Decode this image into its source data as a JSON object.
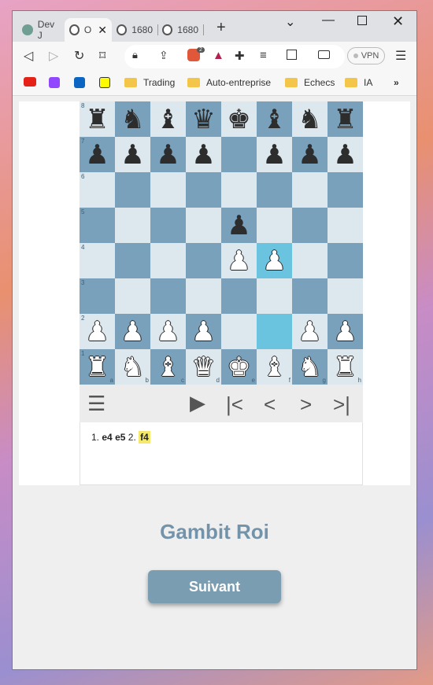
{
  "tabs": [
    {
      "label": "Dev J",
      "icon": "chatgpt-icon",
      "active": false
    },
    {
      "label": "O",
      "icon": "globe-icon",
      "active": true
    },
    {
      "label": "1680",
      "icon": "globe-icon",
      "active": false
    },
    {
      "label": "1680",
      "icon": "globe-icon",
      "active": false
    }
  ],
  "toolbar": {
    "vpn_label": "VPN",
    "brave_badge": "2"
  },
  "bookmarks": [
    {
      "label": "Trading"
    },
    {
      "label": "Auto-entreprise"
    },
    {
      "label": "Echecs"
    },
    {
      "label": "IA"
    }
  ],
  "board": {
    "ranks": [
      "8",
      "7",
      "6",
      "5",
      "4",
      "3",
      "2",
      "1"
    ],
    "files": [
      "a",
      "b",
      "c",
      "d",
      "e",
      "f",
      "g",
      "h"
    ],
    "rows": [
      [
        "bR",
        "bN",
        "bB",
        "bQ",
        "bK",
        "bB",
        "bN",
        "bR"
      ],
      [
        "bP",
        "bP",
        "bP",
        "bP",
        "",
        "bP",
        "bP",
        "bP"
      ],
      [
        "",
        "",
        "",
        "",
        "",
        "",
        "",
        ""
      ],
      [
        "",
        "",
        "",
        "",
        "bP",
        "",
        "",
        ""
      ],
      [
        "",
        "",
        "",
        "",
        "wP",
        "wP",
        "",
        ""
      ],
      [
        "",
        "",
        "",
        "",
        "",
        "",
        "",
        ""
      ],
      [
        "wP",
        "wP",
        "wP",
        "wP",
        "",
        "",
        "wP",
        "wP"
      ],
      [
        "wR",
        "wN",
        "wB",
        "wQ",
        "wK",
        "wB",
        "wN",
        "wR"
      ]
    ],
    "highlight": [
      "f2",
      "f4"
    ]
  },
  "moves": {
    "n1": "1.",
    "m1w": "e4",
    "m1b": "e5",
    "n2": "2.",
    "m2w": "f4"
  },
  "opening_title": "Gambit Roi",
  "next_button": "Suivant"
}
